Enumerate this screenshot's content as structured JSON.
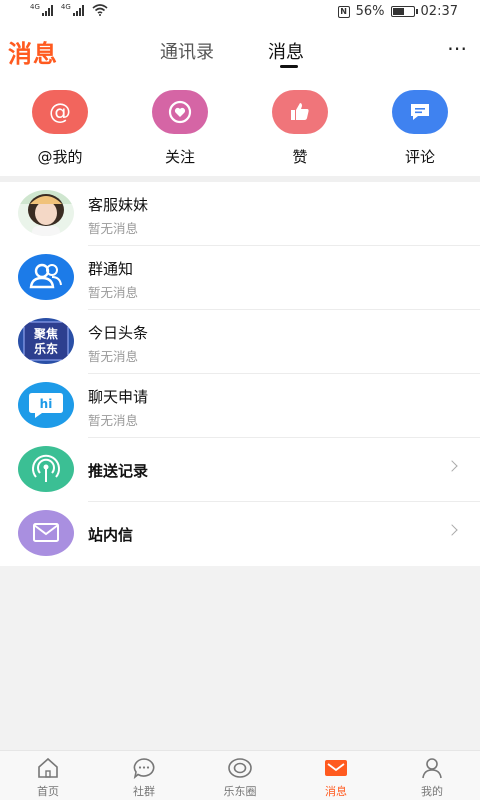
{
  "status_bar": {
    "signal1_label": "4G",
    "signal2_label": "4G",
    "nfc_label": "N",
    "battery_text": "56%",
    "battery_level": 0.56,
    "time": "02:37"
  },
  "header": {
    "brand": "消息",
    "tabs": [
      {
        "label": "通讯录",
        "active": false
      },
      {
        "label": "消息",
        "active": true
      }
    ],
    "more_label": "⋯"
  },
  "quick_actions": [
    {
      "label": "@我的",
      "icon": "at-icon",
      "color": "#f2655d"
    },
    {
      "label": "关注",
      "icon": "heart-icon",
      "color": "#d565a5"
    },
    {
      "label": "赞",
      "icon": "thumbs-up-icon",
      "color": "#f0757a"
    },
    {
      "label": "评论",
      "icon": "comment-icon",
      "color": "#3f82f0"
    }
  ],
  "conversations": [
    {
      "title": "客服妹妹",
      "subtitle": "暂无消息",
      "icon": "avatar-photo"
    },
    {
      "title": "群通知",
      "subtitle": "暂无消息",
      "icon": "group-icon",
      "color": "#1c7be8"
    },
    {
      "title": "今日头条",
      "subtitle": "暂无消息",
      "icon": "news-logo",
      "logo_text": "聚焦乐东",
      "color": "#2a4fa6"
    },
    {
      "title": "聊天申请",
      "subtitle": "暂无消息",
      "icon": "hi-chat-icon",
      "logo_text": "hi",
      "color": "#1e9be8"
    }
  ],
  "links": [
    {
      "title": "推送记录",
      "icon": "broadcast-icon",
      "color": "#3bbf94"
    },
    {
      "title": "站内信",
      "icon": "mail-icon",
      "color": "#a98fe0"
    }
  ],
  "bottom_nav": [
    {
      "label": "首页",
      "icon": "home-icon",
      "active": false
    },
    {
      "label": "社群",
      "icon": "chat-bubble-icon",
      "active": false
    },
    {
      "label": "乐东圈",
      "icon": "circle-icon",
      "active": false
    },
    {
      "label": "消息",
      "icon": "message-icon",
      "active": true
    },
    {
      "label": "我的",
      "icon": "person-icon",
      "active": false
    }
  ],
  "colors": {
    "accent": "#ff5a1f"
  }
}
